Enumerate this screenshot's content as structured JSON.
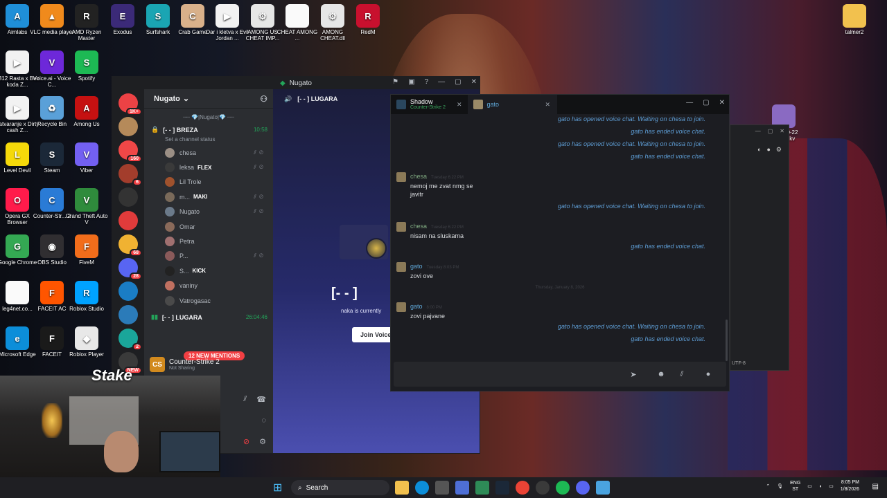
{
  "desktop": {
    "icons": [
      {
        "label": "Aimlabs",
        "color": "#1f8fd8",
        "glyph": "A"
      },
      {
        "label": "VLC media player",
        "color": "#f08a1c",
        "glyph": "▲"
      },
      {
        "label": "AMD Ryzen Master",
        "color": "#222",
        "glyph": "R"
      },
      {
        "label": "Exodus",
        "color": "#3b2a78",
        "glyph": "E"
      },
      {
        "label": "Surfshark",
        "color": "#1aa5b3",
        "glyph": "S"
      },
      {
        "label": "Crab Game",
        "color": "#d8b08a",
        "glyph": "C"
      },
      {
        "label": "Dar i kletva x Evil Jordan ...",
        "color": "#f2f2f2",
        "glyph": "▶"
      },
      {
        "label": "AMONG US CHEAT IMP...",
        "color": "#e6e6e6",
        "glyph": "⚙"
      },
      {
        "label": "CHEAT AMONG ...",
        "color": "#fafafa",
        "glyph": ""
      },
      {
        "label": "AMONG CHEAT.dll",
        "color": "#e6e6e6",
        "glyph": "⚙"
      },
      {
        "label": "RedM",
        "color": "#c8102e",
        "glyph": "R"
      },
      {
        "label": "1312 Rasta x Bez koda Z...",
        "color": "#f2f2f2",
        "glyph": "▶"
      },
      {
        "label": "Voice.ai - Voice C...",
        "color": "#6d28d9",
        "glyph": "V"
      },
      {
        "label": "Spotify",
        "color": "#1db954",
        "glyph": "S"
      },
      {
        "label": "Zatvaranje x Dirty cash Z...",
        "color": "#f2f2f2",
        "glyph": "▶"
      },
      {
        "label": "Recycle Bin",
        "color": "#5aa0d8",
        "glyph": "♻"
      },
      {
        "label": "Among Us",
        "color": "#c51111",
        "glyph": "A"
      },
      {
        "label": "Level Devil",
        "color": "#f5d90a",
        "glyph": "L"
      },
      {
        "label": "Steam",
        "color": "#1b2838",
        "glyph": "S"
      },
      {
        "label": "Viber",
        "color": "#7360f2",
        "glyph": "V"
      },
      {
        "label": "Opera GX Browser",
        "color": "#ff1b4b",
        "glyph": "O"
      },
      {
        "label": "Counter-Str... 2",
        "color": "#2a7bd6",
        "glyph": "C"
      },
      {
        "label": "Grand Theft Auto V",
        "color": "#2f8b3c",
        "glyph": "V"
      },
      {
        "label": "Google Chrome",
        "color": "#34a853",
        "glyph": "G"
      },
      {
        "label": "OBS Studio",
        "color": "#302e31",
        "glyph": "◉"
      },
      {
        "label": "FiveM",
        "color": "#f26d1b",
        "glyph": "F"
      },
      {
        "label": "leg4net.co...",
        "color": "#fafafa",
        "glyph": ""
      },
      {
        "label": "FACEIT AC",
        "color": "#ff5500",
        "glyph": "F"
      },
      {
        "label": "Roblox Studio",
        "color": "#00a2ff",
        "glyph": "R"
      },
      {
        "label": "Microsoft Edge",
        "color": "#0c8ed9",
        "glyph": "e"
      },
      {
        "label": "FACEIT",
        "color": "#1a1a1a",
        "glyph": "F"
      },
      {
        "label": "Roblox Player",
        "color": "#e8e8e8",
        "glyph": "◆"
      },
      {
        "label": "talmer2",
        "color": "#f2c14e",
        "glyph": ""
      },
      {
        "label": "2025-10-22 ...48.mkv",
        "color": "#8a6ac2",
        "glyph": ""
      }
    ]
  },
  "discord": {
    "window_title": "Nugato",
    "server_name": "Nugato",
    "category": "|Nugato|",
    "voice_channel_1": "[- - ] BREZA",
    "voice_channel_1_time": "10:58",
    "channel_status": "Set a channel status",
    "members": [
      {
        "name": "chesa",
        "tag": ""
      },
      {
        "name": "leksa",
        "tag": "FLEX"
      },
      {
        "name": "Lil Trole",
        "tag": ""
      },
      {
        "name": "m...",
        "tag": "MAKI"
      },
      {
        "name": "Nugato",
        "tag": ""
      },
      {
        "name": "Omar",
        "tag": ""
      },
      {
        "name": "Petra",
        "tag": ""
      },
      {
        "name": "P...",
        "tag": ""
      },
      {
        "name": "S...",
        "tag": "KICK"
      },
      {
        "name": "vaniny",
        "tag": ""
      },
      {
        "name": "Vatrogasac",
        "tag": ""
      }
    ],
    "voice_channel_2": "[- - ] LUGARA",
    "voice_channel_2_time": "26:04:46",
    "mentions_badge": "12 NEW MENTIONS",
    "game": "Counter-Strike 2",
    "game_status": "Not Sharing",
    "main_header": "[- - ] LUGARA",
    "main_big": "[- - ]",
    "main_sub": "naka is currently",
    "join_button": "Join Voice",
    "guild_badges": [
      "1K+",
      "160",
      "6",
      "28",
      "68",
      "2",
      "NEW"
    ]
  },
  "overlay": {
    "brand": "Stake"
  },
  "chat": {
    "tab1_name": "Shadow",
    "tab1_game": "Counter-Strike 2",
    "tab2_name": "gato",
    "messages": [
      {
        "type": "system",
        "text": "gato has opened voice chat. Waiting on chesa to join."
      },
      {
        "type": "system",
        "text": "gato has ended voice chat."
      },
      {
        "type": "system",
        "text": "gato has opened voice chat. Waiting on chesa to join."
      },
      {
        "type": "system",
        "text": "gato has ended voice chat."
      },
      {
        "type": "user",
        "author": "chesa",
        "time": "Tuesday 6:22 PM",
        "text": "nemoj me zvat nmg se javitr"
      },
      {
        "type": "system",
        "text": "gato has opened voice chat. Waiting on chesa to join."
      },
      {
        "type": "user",
        "author": "chesa",
        "time": "Tuesday 6:22 PM",
        "text": "nisam na sluskama"
      },
      {
        "type": "system",
        "text": "gato has ended voice chat."
      },
      {
        "type": "user",
        "author": "gato",
        "time": "Tuesday 8:03 PM",
        "text": "zovi ove"
      },
      {
        "type": "separator",
        "text": "Thursday, January 8, 2026"
      },
      {
        "type": "user",
        "author": "gato",
        "time": "8:00 PM",
        "text": "zovi pajvane"
      },
      {
        "type": "system",
        "text": "gato has opened voice chat. Waiting on chesa to join."
      },
      {
        "type": "system",
        "text": "gato has ended voice chat."
      }
    ]
  },
  "browser_ghost": {
    "encoding": "UTF-8"
  },
  "taskbar": {
    "search_placeholder": "Search",
    "lang": "ENG",
    "lang2": "ST",
    "time": "8:05 PM",
    "date": "1/8/2026"
  },
  "colors": {
    "discord_bg": "#313338",
    "online_green": "#23a55a",
    "mention_red": "#f23f43",
    "system_msg": "#5e9ed6",
    "chesa_name": "#7ea77f",
    "gato_name": "#5ea6d6"
  }
}
